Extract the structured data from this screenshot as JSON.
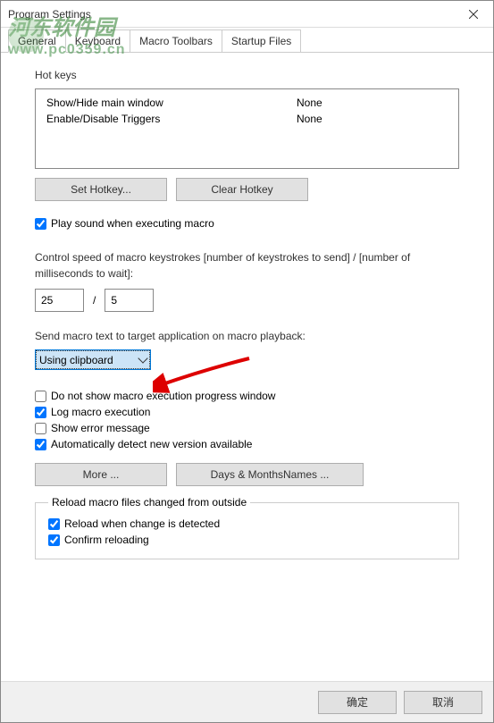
{
  "window": {
    "title": "Program Settings"
  },
  "tabs": [
    "General",
    "Keyboard",
    "Macro Toolbars",
    "Startup Files"
  ],
  "hotkeys": {
    "label": "Hot keys",
    "rows": [
      {
        "name": "Show/Hide main window",
        "value": "None"
      },
      {
        "name": "Enable/Disable Triggers",
        "value": "None"
      }
    ],
    "set_btn": "Set Hotkey...",
    "clear_btn": "Clear Hotkey"
  },
  "play_sound": {
    "label": "Play sound when executing macro",
    "checked": true
  },
  "speed": {
    "label": "Control speed of macro keystrokes [number of keystrokes to send] / [number of milliseconds to wait]:",
    "n1": "25",
    "sep": "/",
    "n2": "5"
  },
  "send_macro": {
    "label": "Send macro text to target application on macro playback:",
    "combo": "Using clipboard"
  },
  "checks": {
    "c1": {
      "label": "Do not show macro execution progress window",
      "checked": false
    },
    "c2": {
      "label": "Log macro execution",
      "checked": true
    },
    "c3": {
      "label": "Show error message",
      "checked": false
    },
    "c4": {
      "label": "Automatically detect new version available",
      "checked": true
    }
  },
  "more_btn": "More ...",
  "days_btn": "Days & MonthsNames ...",
  "reload": {
    "legend": "Reload macro files changed from outside",
    "r1": {
      "label": "Reload when change is detected",
      "checked": true
    },
    "r2": {
      "label": "Confirm reloading",
      "checked": true
    }
  },
  "footer": {
    "ok": "确定",
    "cancel": "取消"
  },
  "watermark": {
    "line1": "河东软件园",
    "line2": "www.pc0359.cn"
  }
}
